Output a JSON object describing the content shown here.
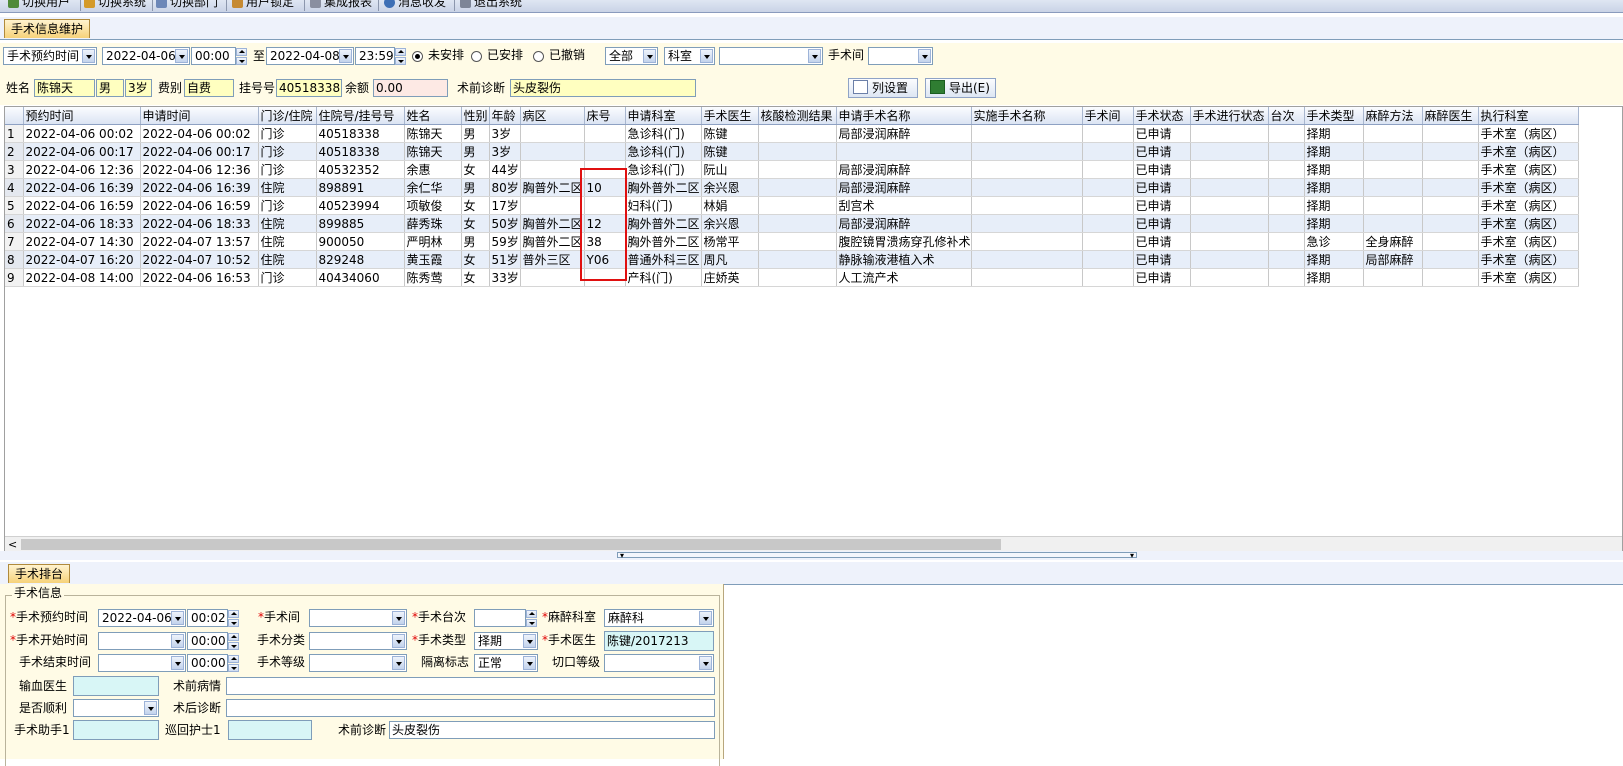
{
  "toolbar": {
    "items": [
      {
        "label": "切换用户",
        "icon": "switch-user-icon"
      },
      {
        "label": "切换系统",
        "icon": "switch-system-icon"
      },
      {
        "label": "切换部门",
        "icon": "switch-dept-icon"
      },
      {
        "label": "用户锁定",
        "icon": "user-lock-icon"
      },
      {
        "label": "集成报表",
        "icon": "report-icon"
      },
      {
        "label": "消息收发",
        "icon": "message-icon"
      },
      {
        "label": "退出系统",
        "icon": "exit-icon"
      }
    ]
  },
  "top_tab": "手术信息维护",
  "filters": {
    "time_type": "手术预约时间",
    "start_date": "2022-04-06",
    "start_time": "00:00",
    "to_label": "至",
    "end_date": "2022-04-08",
    "end_time": "23:59",
    "radio_unscheduled": "未安排",
    "radio_scheduled": "已安排",
    "radio_cancelled": "已撤销",
    "radio_selected": "未安排",
    "scope": "全部",
    "dept": "科室",
    "dept_value": "",
    "room_label": "手术间",
    "room_value": ""
  },
  "patient": {
    "name_label": "姓名",
    "name": "陈锦天",
    "gender": "男",
    "age": "3岁",
    "fee_label": "费别",
    "fee": "自费",
    "reg_label": "挂号号",
    "reg_no": "40518338",
    "balance_label": "余额",
    "balance": "0.00",
    "diag_label": "术前诊断",
    "diagnosis": "头皮裂伤"
  },
  "buttons": {
    "columns": "列设置",
    "export": "导出(E)"
  },
  "grid": {
    "columns": [
      "预约时间",
      "申请时间",
      "门诊/住院",
      "住院号/挂号号",
      "姓名",
      "性别",
      "年龄",
      "病区",
      "床号",
      "申请科室",
      "手术医生",
      "核酸检测结果",
      "申请手术名称",
      "实施手术名称",
      "手术间",
      "手术状态",
      "手术进行状态",
      "台次",
      "手术类型",
      "麻醉方法",
      "麻醉医生",
      "执行科室"
    ],
    "rows": [
      [
        "1",
        "2022-04-06 00:02",
        "2022-04-06 00:02",
        "门诊",
        "40518338",
        "陈锦天",
        "男",
        "3岁",
        "",
        "",
        "急诊科(门)",
        "陈键",
        "",
        "局部浸润麻醉",
        "",
        "",
        "已申请",
        "",
        "",
        "择期",
        "",
        "",
        "手术室（病区）"
      ],
      [
        "2",
        "2022-04-06 00:17",
        "2022-04-06 00:17",
        "门诊",
        "40518338",
        "陈锦天",
        "男",
        "3岁",
        "",
        "",
        "急诊科(门)",
        "陈键",
        "",
        "",
        "",
        "",
        "已申请",
        "",
        "",
        "择期",
        "",
        "",
        "手术室（病区）"
      ],
      [
        "3",
        "2022-04-06 12:36",
        "2022-04-06 12:36",
        "门诊",
        "40532352",
        "余惠",
        "女",
        "44岁",
        "",
        "",
        "急诊科(门)",
        "阮山",
        "",
        "局部浸润麻醉",
        "",
        "",
        "已申请",
        "",
        "",
        "择期",
        "",
        "",
        "手术室（病区）"
      ],
      [
        "4",
        "2022-04-06 16:39",
        "2022-04-06 16:39",
        "住院",
        "898891",
        "余仁华",
        "男",
        "80岁",
        "胸普外二区",
        "10",
        "胸外普外二区",
        "余兴恩",
        "",
        "局部浸润麻醉",
        "",
        "",
        "已申请",
        "",
        "",
        "择期",
        "",
        "",
        "手术室（病区）"
      ],
      [
        "5",
        "2022-04-06 16:59",
        "2022-04-06 16:59",
        "门诊",
        "40523994",
        "项敏俊",
        "女",
        "17岁",
        "",
        "",
        "妇科(门)",
        "林娟",
        "",
        "刮宫术",
        "",
        "",
        "已申请",
        "",
        "",
        "择期",
        "",
        "",
        "手术室（病区）"
      ],
      [
        "6",
        "2022-04-06 18:33",
        "2022-04-06 18:33",
        "住院",
        "899885",
        "薛秀珠",
        "女",
        "50岁",
        "胸普外二区",
        "12",
        "胸外普外二区",
        "余兴恩",
        "",
        "局部浸润麻醉",
        "",
        "",
        "已申请",
        "",
        "",
        "择期",
        "",
        "",
        "手术室（病区）"
      ],
      [
        "7",
        "2022-04-07 14:30",
        "2022-04-07 13:57",
        "住院",
        "900050",
        "严明林",
        "男",
        "59岁",
        "胸普外二区",
        "38",
        "胸外普外二区",
        "杨常平",
        "",
        "腹腔镜胃溃疡穿孔修补术",
        "",
        "",
        "已申请",
        "",
        "",
        "急诊",
        "全身麻醉",
        "",
        "手术室（病区）"
      ],
      [
        "8",
        "2022-04-07 16:20",
        "2022-04-07 10:52",
        "住院",
        "829248",
        "黄玉霞",
        "女",
        "51岁",
        "普外三区",
        "Y06",
        "普通外科三区",
        "周凡",
        "",
        "静脉输液港植入术",
        "",
        "",
        "已申请",
        "",
        "",
        "择期",
        "局部麻醉",
        "",
        "手术室（病区）"
      ],
      [
        "9",
        "2022-04-08 14:00",
        "2022-04-06 16:53",
        "门诊",
        "40434060",
        "陈秀莺",
        "女",
        "33岁",
        "",
        "",
        "产科(门)",
        "庄娇英",
        "",
        "人工流产术",
        "",
        "",
        "已申请",
        "",
        "",
        "择期",
        "",
        "",
        "手术室（病区）"
      ]
    ]
  },
  "bottom_tab": "手术排台",
  "form": {
    "group_title": "手术信息",
    "appt_time_label": "手术预约时间",
    "appt_date": "2022-04-06",
    "appt_time": "00:02",
    "room_label": "手术间",
    "room": "",
    "seq_label": "手术台次",
    "seq": "",
    "anes_dept_label": "麻醉科室",
    "anes_dept": "麻醉科",
    "start_label": "手术开始时间",
    "start_date": "",
    "start_time": "00:00",
    "category_label": "手术分类",
    "category": "",
    "type_label": "手术类型",
    "type": "择期",
    "surgeon_label": "手术医生",
    "surgeon": "陈键/2017213",
    "end_label": "手术结束时间",
    "end_date": "",
    "end_time": "00:00",
    "level_label": "手术等级",
    "level": "",
    "isolation_label": "隔离标志",
    "isolation": "正常",
    "incision_label": "切口等级",
    "incision": "",
    "transfusion_label": "输血医生",
    "transfusion": "",
    "preop_cond_label": "术前病情",
    "preop_cond": "",
    "smooth_label": "是否顺利",
    "smooth": "",
    "postop_diag_label": "术后诊断",
    "postop_diag": "",
    "assistant_label": "手术助手1",
    "circ_nurse_label": "巡回护士1",
    "preop_diag_label": "术前诊断",
    "preop_diag": "头皮裂伤"
  }
}
